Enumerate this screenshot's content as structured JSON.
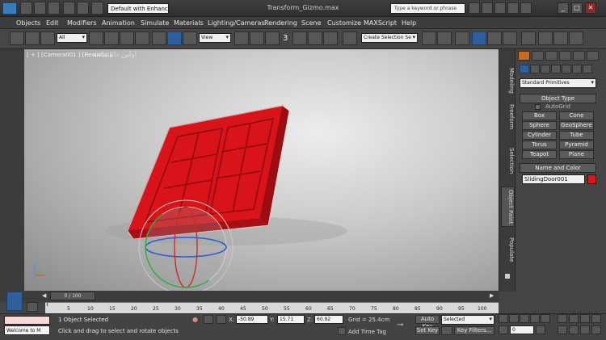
{
  "titlebar": {
    "app_title": "Transform_Gizmo.max",
    "workspace": "Default with Enhance",
    "search_placeholder": "Type a keyword or phrase",
    "win_min": "_",
    "win_max": "□",
    "win_close": "✕"
  },
  "menu": {
    "items": [
      "Objects",
      "Edit",
      "Modifiers",
      "Animation",
      "Simulate",
      "Materials",
      "Lighting/Cameras",
      "Rendering",
      "Scene",
      "Customize",
      "MAXScript",
      "Help"
    ]
  },
  "toolbar": {
    "filter": "All",
    "ref_coord": "View",
    "snap_label": "3",
    "selection_set": "Create Selection Se"
  },
  "viewport": {
    "label": "[ + ] [Camera001 ] [Realistic ]",
    "watermark": "اولین دانشنامه"
  },
  "cmdpanel": {
    "tabs": [
      "Modeling",
      "Freeform",
      "Selection",
      "Object Paint",
      "Populate"
    ],
    "category": "Standard Primitives",
    "object_type_header": "Object Type",
    "autogrid": "AutoGrid",
    "buttons": [
      "Box",
      "Cone",
      "Sphere",
      "GeoSphere",
      "Cylinder",
      "Tube",
      "Torus",
      "Pyramid",
      "Teapot",
      "Plane"
    ],
    "name_color_header": "Name and Color",
    "object_name": "SlidingDoor001",
    "color": "#e0141b"
  },
  "timeline": {
    "frame": "0 / 100",
    "ticks": [
      "5",
      "10",
      "15",
      "20",
      "25",
      "30",
      "35",
      "40",
      "45",
      "50",
      "55",
      "60",
      "65",
      "70",
      "75",
      "80",
      "85",
      "90",
      "95",
      "100"
    ]
  },
  "status": {
    "welcome": "Welcome to M",
    "selected": "1 Object Selected",
    "prompt": "Click and drag to select and rotate objects",
    "x_label": "X:",
    "x_value": "-50.89",
    "y_label": "Y:",
    "y_value": "15.71",
    "z_label": "Z:",
    "z_value": "60.92",
    "grid": "Grid = 25.4cm",
    "add_time_tag": "Add Time Tag",
    "auto_key": "Auto Key",
    "key_mode": "Selected",
    "set_key": "Set Key",
    "key_filters": "Key Filters...",
    "frame_field": "0"
  }
}
